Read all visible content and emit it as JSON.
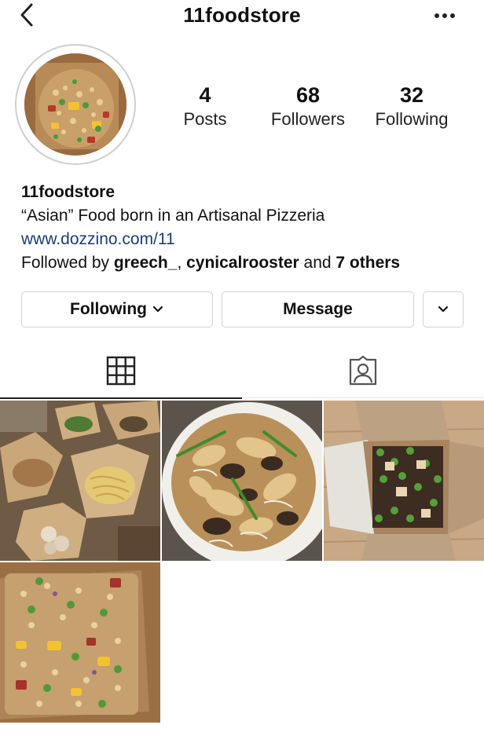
{
  "header": {
    "username": "11foodstore",
    "back_icon": "chevron-left-icon",
    "more_icon": "more-horizontal-icon"
  },
  "profile": {
    "stats": [
      {
        "value": "4",
        "label": "Posts"
      },
      {
        "value": "68",
        "label": "Followers"
      },
      {
        "value": "32",
        "label": "Following"
      }
    ],
    "name": "11foodstore",
    "bio": "“Asian” Food born in an Artisanal Pizzeria",
    "link": "www.dozzino.com/11",
    "followed_by": {
      "prefix": "Followed by ",
      "user1": "greech_",
      "separator": ", ",
      "user2": "cynicalrooster",
      "middle": " and ",
      "others": "7 others"
    }
  },
  "actions": {
    "following_label": "Following",
    "message_label": "Message"
  },
  "tabs": [
    {
      "icon": "grid-icon",
      "active": true
    },
    {
      "icon": "tagged-person-icon",
      "active": false
    }
  ],
  "posts": [
    {
      "subject": "takeout boxes with noodles"
    },
    {
      "subject": "stir fried wide noodles"
    },
    {
      "subject": "takeout box with tofu"
    },
    {
      "subject": "fried rice in takeout box"
    }
  ],
  "colors": {
    "link": "#1a3e73",
    "border": "#d4d4d4",
    "text": "#111111"
  }
}
